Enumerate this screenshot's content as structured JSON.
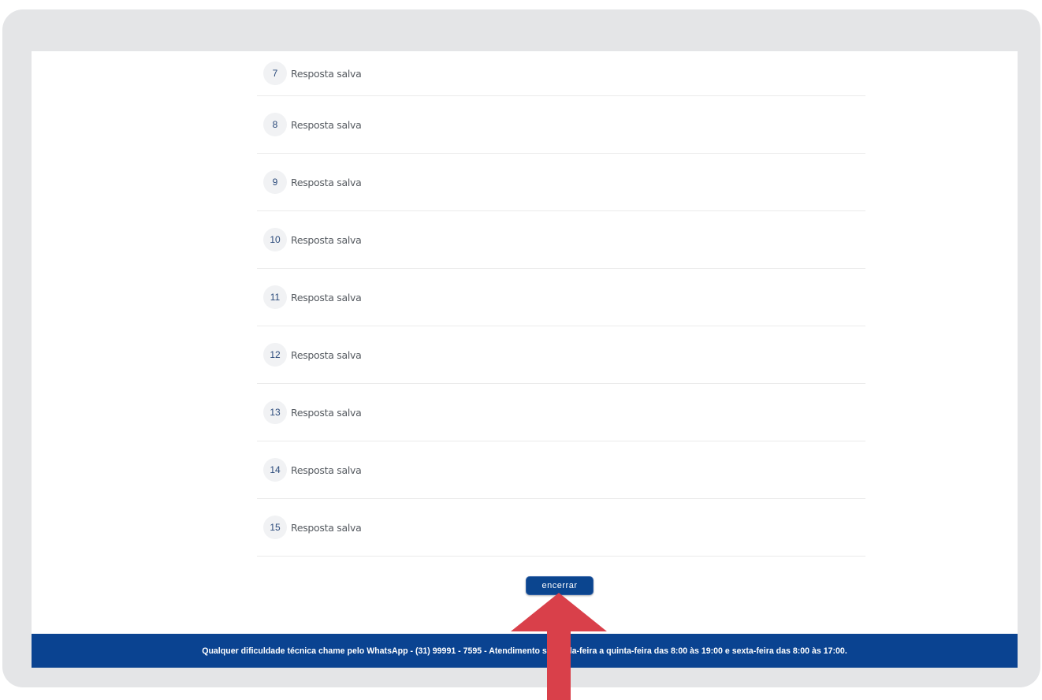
{
  "summary": {
    "rows": [
      {
        "number": "7",
        "status": "Resposta salva"
      },
      {
        "number": "8",
        "status": "Resposta salva"
      },
      {
        "number": "9",
        "status": "Resposta salva"
      },
      {
        "number": "10",
        "status": "Resposta salva"
      },
      {
        "number": "11",
        "status": "Resposta salva"
      },
      {
        "number": "12",
        "status": "Resposta salva"
      },
      {
        "number": "13",
        "status": "Resposta salva"
      },
      {
        "number": "14",
        "status": "Resposta salva"
      },
      {
        "number": "15",
        "status": "Resposta salva"
      }
    ]
  },
  "actions": {
    "finish_label": "encerrar"
  },
  "footer": {
    "text": "Qualquer dificuldade técnica chame pelo WhatsApp - (31) 99991 - 7595 - Atendimento segunda-feira a quinta-feira das 8:00 às 19:00 e sexta-feira das 8:00 às 17:00."
  },
  "annotation": {
    "icon": "arrow-up-icon",
    "color": "#d9404a"
  },
  "colors": {
    "frame": "#e4e5e7",
    "brand_blue": "#0a4391",
    "button_blue": "#0b458f"
  }
}
